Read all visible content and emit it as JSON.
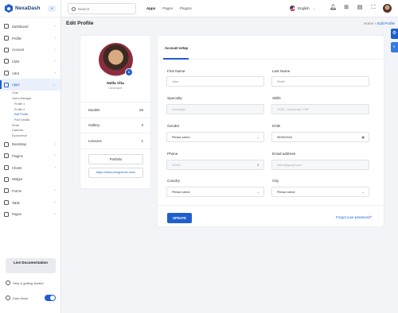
{
  "brand": {
    "name": "NexaDash",
    "toggle_icon": "arrow-left-icon",
    "accent": "#1f5fcc"
  },
  "sidebar": {
    "items": [
      {
        "label": "Dashboard"
      },
      {
        "label": "Profile"
      },
      {
        "label": "Account"
      },
      {
        "label": "CMS"
      },
      {
        "label": "AIKit"
      },
      {
        "label": "Apps"
      }
    ],
    "subitems": [
      {
        "label": "Chat"
      },
      {
        "label": "Users Manager"
      },
      {
        "label": "Profile 1"
      },
      {
        "label": "Profile 2"
      },
      {
        "label": "Edit Profile"
      },
      {
        "label": "Post Details"
      },
      {
        "label": "Email"
      },
      {
        "label": "Calendar"
      },
      {
        "label": "Ecommerce"
      }
    ],
    "items2": [
      {
        "label": "Bootstrap"
      },
      {
        "label": "Plugins"
      },
      {
        "label": "Charts"
      },
      {
        "label": "Widget"
      },
      {
        "label": "Forms"
      },
      {
        "label": "Table"
      },
      {
        "label": "Pages"
      }
    ],
    "doc_button": "Live Documentation",
    "help": "Help & getting started",
    "dark_mode": "Dark Mode"
  },
  "topbar": {
    "search_placeholder": "Search",
    "nav": [
      "Apps",
      "Pages",
      "Plugins"
    ],
    "language": "English"
  },
  "page": {
    "title": "Edit Profile",
    "crumb_home": "Home",
    "crumb_sep": "»",
    "crumb_current": "Edit Profile"
  },
  "profile": {
    "name": "Nella Vita",
    "role": "Developer",
    "stats": [
      {
        "label": "Models",
        "value": "28"
      },
      {
        "label": "Gallery",
        "value": "3"
      },
      {
        "label": "Lessons",
        "value": "1"
      }
    ],
    "portfolio_label": "Portfolio",
    "link": "https://www.dexignzone.com/"
  },
  "form": {
    "tab": "Account setup",
    "first_name_label": "First Name",
    "first_name_ph": "John",
    "last_name_label": "Last Name",
    "last_name_ph": "Smith",
    "specialty_label": "Specialty",
    "specialty_ph": "Developer",
    "skills_label": "Skills",
    "skills_ph": "HTML,  JavaScript,  PHP",
    "gender_label": "Gender",
    "gender_value": "Please select",
    "dob_label": "DOB",
    "dob_value": "06/08/2024",
    "phone_label": "Phone",
    "phone_ph": "12345",
    "email_label": "Email address",
    "email_ph": "demo@gmail.com",
    "country_label": "Country",
    "country_value": "Please select",
    "city_label": "City",
    "city_value": "Please select",
    "update_label": "UPDATE",
    "forgot_label": "Forgot your password?"
  }
}
